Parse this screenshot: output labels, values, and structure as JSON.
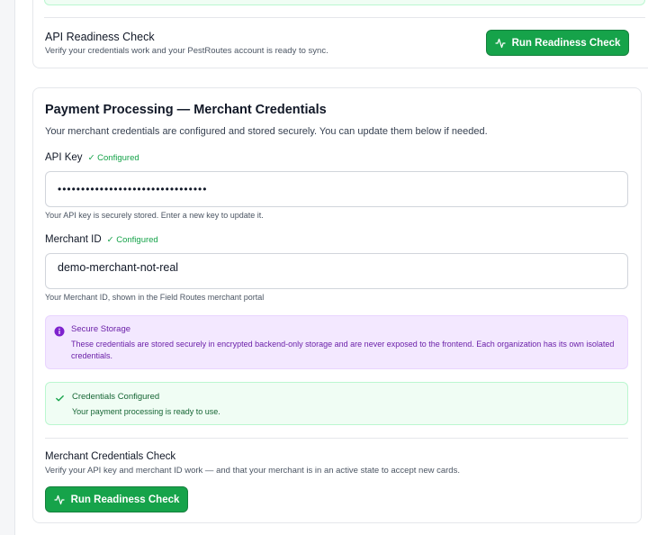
{
  "top_card": {
    "title": "API Readiness Check",
    "subtitle": "Verify your credentials work and your PestRoutes account is ready to sync.",
    "button_label": "Run Readiness Check"
  },
  "merchant_card": {
    "title": "Payment Processing — Merchant Credentials",
    "description": "Your merchant credentials are configured and stored securely. You can update them below if needed.",
    "api_key": {
      "label": "API Key",
      "status": "✓ Configured",
      "value": "••••••••••••••••••••••••••••••••",
      "help": "Your API key is securely stored. Enter a new key to update it."
    },
    "merchant_id": {
      "label": "Merchant ID",
      "status": "✓ Configured",
      "value": "demo-merchant-not-real",
      "help": "Your Merchant ID, shown in the Field Routes merchant portal"
    },
    "secure_storage": {
      "title": "Secure Storage",
      "body": "These credentials are stored securely in encrypted backend-only storage and are never exposed to the frontend. Each organization has its own isolated credentials."
    },
    "configured_alert": {
      "title": "Credentials Configured",
      "body": "Your payment processing is ready to use."
    },
    "check": {
      "title": "Merchant Credentials Check",
      "subtitle": "Verify your API key and merchant ID work — and that your merchant is in an active state to accept new cards.",
      "button_label": "Run Readiness Check"
    }
  },
  "colors": {
    "primary_green": "#16a34a",
    "purple_alert_bg": "#f3e8ff",
    "purple_text": "#6b21a8",
    "green_text": "#166534"
  },
  "icons": {
    "readiness": "activity-icon",
    "info": "info-icon",
    "check": "check-icon"
  }
}
